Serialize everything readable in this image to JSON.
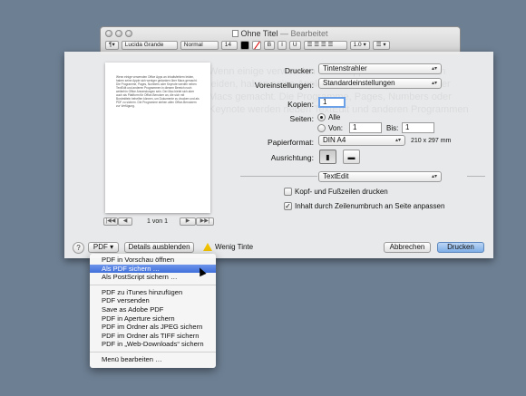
{
  "window": {
    "title": "Ohne Titel",
    "edited": "— Bearbeitet",
    "toolbar": {
      "font_family": "Lucida Grande",
      "font_style": "Normal",
      "font_size": "14",
      "bold": "B",
      "italic": "I",
      "underline": "U",
      "line_spacing": "1.0",
      "list": "☰"
    }
  },
  "preview": {
    "page_text": "Wenn einige verwenden Office Apps an Inhaltsfehlern leiden, haben seine Apple sich weniger gedanken über Macs gemacht. Die Programme, Pages, Numbers oder Keynote werden neben TextEdit und anderen Programmen in diesem Bereich noch weiterhin Office Anwendungen sein. Der Mac bietet sich aber auch als Plattform für Office-Benutzer an, die sich mit Bordmitteln behelfen können, um Dokumente zu drucken und als PDF zu sichern. Die Programme stehen allen Office-Benutzern zur Verfügung.",
    "page_counter": "1 von 1",
    "first": "|◀◀",
    "prev": "◀",
    "next": "▶",
    "last": "▶▶|"
  },
  "ghost_text": "Wenn einige verwenden Office Apps an Inhaltsfehlern leiden, haben seine Apple sich weniger gedanken über Macs gemacht. Die Programme, Pages, Numbers oder Keynote werden neben TextEdit und anderen Programmen",
  "print": {
    "printer_label": "Drucker:",
    "printer_value": "Tintenstrahler",
    "presets_label": "Voreinstellungen:",
    "presets_value": "Standardeinstellungen",
    "copies_label": "Kopien:",
    "copies_value": "1",
    "pages_label": "Seiten:",
    "pages_all": "Alle",
    "pages_from": "Von:",
    "pages_from_value": "1",
    "pages_to": "Bis:",
    "pages_to_value": "1",
    "paper_label": "Papierformat:",
    "paper_value": "DIN A4",
    "paper_dims": "210 x 297 mm",
    "orientation_label": "Ausrichtung:",
    "app_section": "TextEdit",
    "header_footer": "Kopf- und Fußzeilen drucken",
    "rewrap": "Inhalt durch Zeilenumbruch an Seite anpassen",
    "rewrap_checked": "✓"
  },
  "bottom": {
    "help": "?",
    "pdf_button": "PDF",
    "details_button": "Details ausblenden",
    "warning": "Wenig Tinte",
    "cancel": "Abbrechen",
    "print": "Drucken"
  },
  "pdf_menu": {
    "group1": [
      "PDF in Vorschau öffnen",
      "Als PDF sichern …",
      "Als PostScript sichern …"
    ],
    "group2": [
      "PDF zu iTunes hinzufügen",
      "PDF versenden",
      "Save as Adobe PDF",
      "PDF in Aperture sichern",
      "PDF im Ordner als JPEG sichern",
      "PDF im Ordner als TIFF sichern",
      "PDF in „Web-Downloads“ sichern"
    ],
    "group3": [
      "Menü bearbeiten …"
    ],
    "highlighted": "Als PDF sichern …"
  }
}
